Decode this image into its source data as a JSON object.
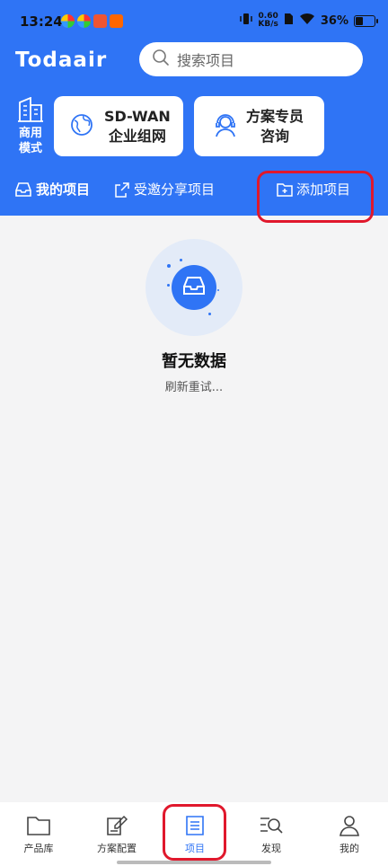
{
  "status_bar": {
    "time": "13:24",
    "speed_value": "0.60",
    "speed_unit": "KB/s",
    "battery": "36%",
    "battery_level": 0.36
  },
  "header": {
    "logo": "Todaair",
    "search_placeholder": "搜索项目",
    "mode_label_line1": "商用",
    "mode_label_line2": "模式",
    "cards": [
      {
        "line1": "SD-WAN",
        "line2": "企业组网",
        "icon": "globe-icon"
      },
      {
        "line1": "方案专员",
        "line2": "咨询",
        "icon": "headset-icon"
      }
    ],
    "tabs": [
      {
        "label": "我的项目",
        "icon": "inbox-icon"
      },
      {
        "label": "受邀分享项目",
        "icon": "share-icon"
      },
      {
        "label": "添加项目",
        "icon": "folder-plus-icon"
      }
    ]
  },
  "empty_state": {
    "title": "暂无数据",
    "subtitle": "刷新重试..."
  },
  "bottom_nav": [
    {
      "label": "产品库",
      "icon": "folder-icon"
    },
    {
      "label": "方案配置",
      "icon": "edit-icon"
    },
    {
      "label": "项目",
      "icon": "list-icon",
      "active": true
    },
    {
      "label": "发现",
      "icon": "discover-icon"
    },
    {
      "label": "我的",
      "icon": "user-icon"
    }
  ],
  "colors": {
    "brand": "#2f74f5",
    "highlight": "#e0182c"
  }
}
